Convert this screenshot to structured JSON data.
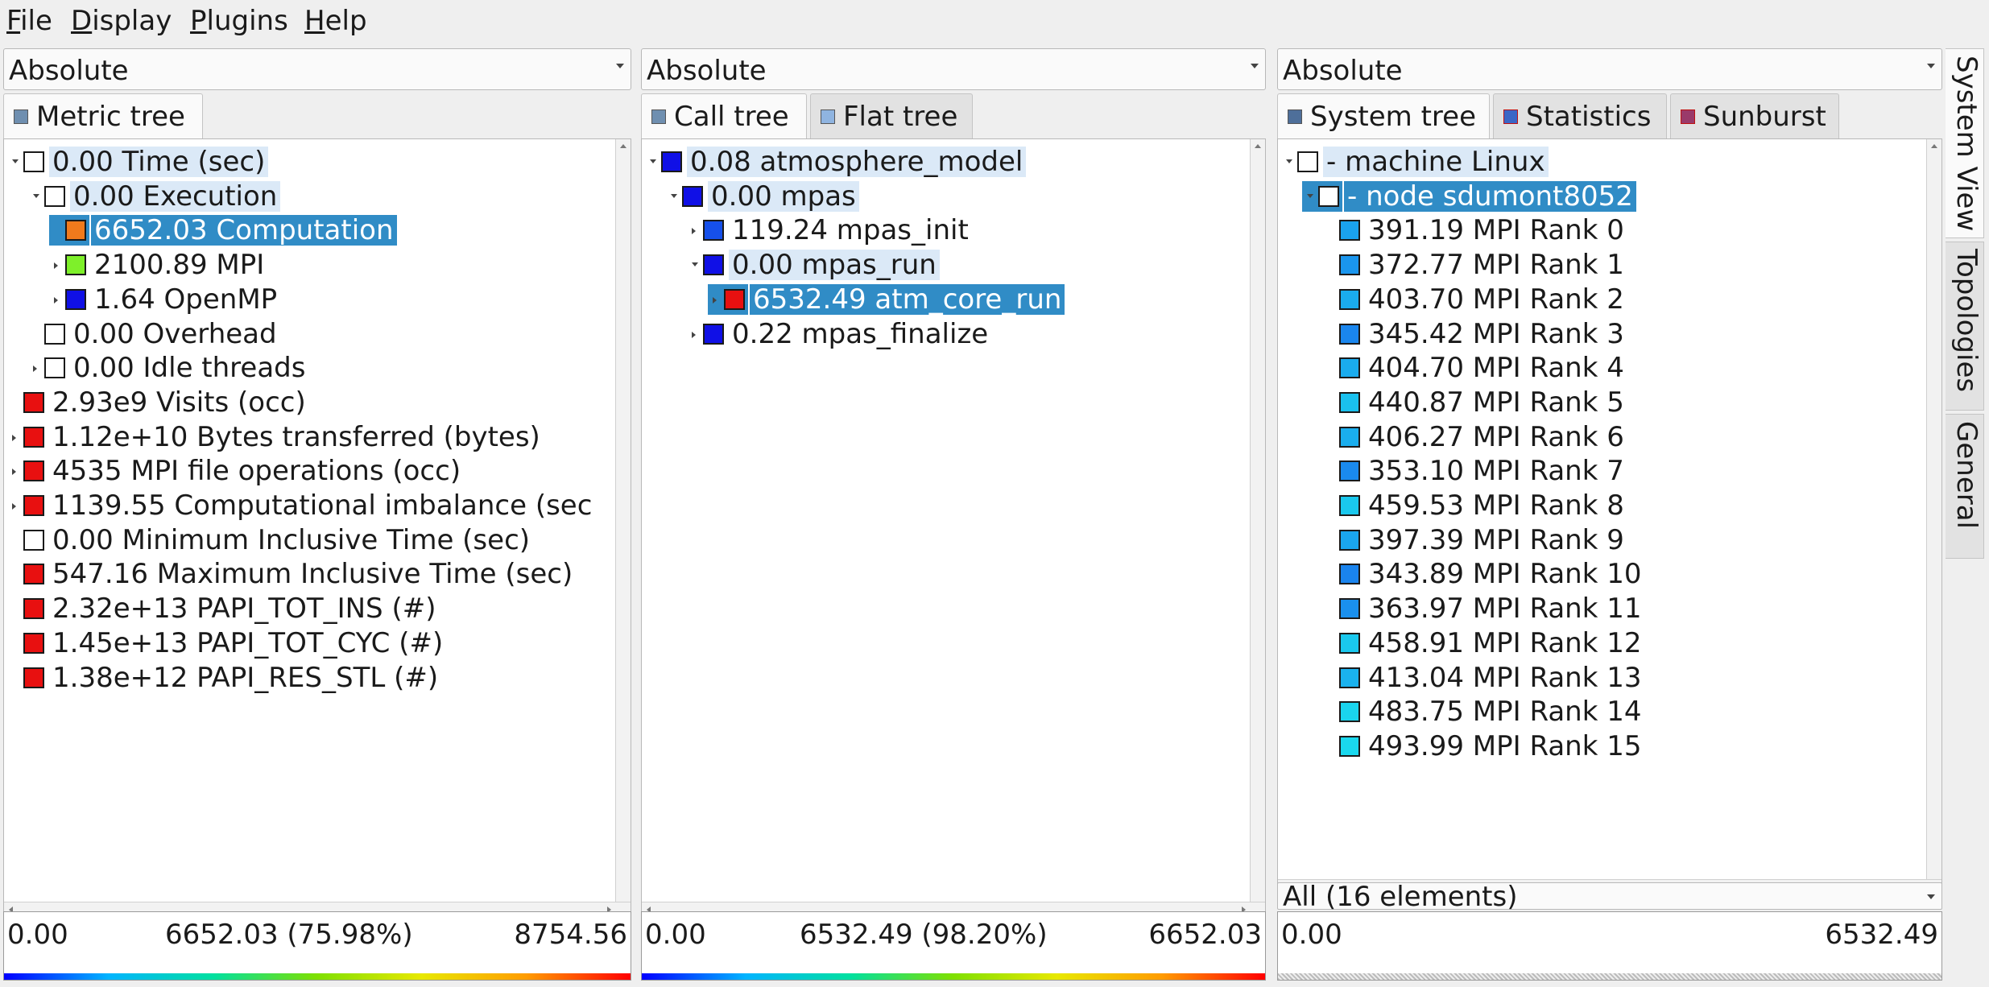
{
  "menubar": {
    "items": [
      {
        "first": "F",
        "rest": "ile"
      },
      {
        "first": "D",
        "rest": "isplay"
      },
      {
        "first": "P",
        "rest": "lugins"
      },
      {
        "first": "H",
        "rest": "elp"
      }
    ]
  },
  "metric_panel": {
    "mode": "Absolute",
    "tabs": [
      {
        "label": "Metric tree"
      }
    ],
    "rows": [
      {
        "text": "0.00 Time (sec)",
        "color": "#ffffff",
        "expander": "open"
      },
      {
        "text": "0.00 Execution",
        "color": "#ffffff",
        "expander": "open"
      },
      {
        "text": "6652.03 Computation",
        "color": "#f07a1c",
        "expander": "none",
        "selected": true
      },
      {
        "text": "2100.89 MPI",
        "color": "#7ef02a",
        "expander": "closed"
      },
      {
        "text": "1.64 OpenMP",
        "color": "#1010e6",
        "expander": "closed"
      },
      {
        "text": "0.00 Overhead",
        "color": "#ffffff",
        "expander": "none"
      },
      {
        "text": "0.00 Idle threads",
        "color": "#ffffff",
        "expander": "closed"
      },
      {
        "text": "2.93e9 Visits (occ)",
        "color": "#e81010",
        "expander": "none"
      },
      {
        "text": "1.12e+10 Bytes transferred (bytes)",
        "color": "#e81010",
        "expander": "closed"
      },
      {
        "text": "4535 MPI file operations (occ)",
        "color": "#e81010",
        "expander": "closed"
      },
      {
        "text": "1139.55 Computational imbalance (sec",
        "color": "#e81010",
        "expander": "closed"
      },
      {
        "text": "0.00 Minimum Inclusive Time (sec)",
        "color": "#ffffff",
        "expander": "none"
      },
      {
        "text": "547.16 Maximum Inclusive Time (sec)",
        "color": "#e81010",
        "expander": "none"
      },
      {
        "text": "2.32e+13 PAPI_TOT_INS (#)",
        "color": "#e81010",
        "expander": "none"
      },
      {
        "text": "1.45e+13 PAPI_TOT_CYC (#)",
        "color": "#e81010",
        "expander": "none"
      },
      {
        "text": "1.38e+12 PAPI_RES_STL (#)",
        "color": "#e81010",
        "expander": "none"
      }
    ],
    "scale": {
      "min": "0.00",
      "mid": "6652.03 (75.98%)",
      "max": "8754.56"
    }
  },
  "call_panel": {
    "mode": "Absolute",
    "tabs": [
      {
        "label": "Call tree"
      },
      {
        "label": "Flat tree"
      }
    ],
    "rows": [
      {
        "text": "0.08 atmosphere_model",
        "color": "#1010e6",
        "expander": "open"
      },
      {
        "text": "0.00 mpas",
        "color": "#1010e6",
        "expander": "open"
      },
      {
        "text": "119.24 mpas_init",
        "color": "#1650ea",
        "expander": "closed"
      },
      {
        "text": "0.00 mpas_run",
        "color": "#1010e6",
        "expander": "open"
      },
      {
        "text": "6532.49 atm_core_run",
        "color": "#e81010",
        "expander": "closed",
        "selected": true
      },
      {
        "text": "0.22 mpas_finalize",
        "color": "#1010e6",
        "expander": "closed"
      }
    ],
    "scale": {
      "min": "0.00",
      "mid": "6532.49 (98.20%)",
      "max": "6652.03"
    }
  },
  "system_panel": {
    "mode": "Absolute",
    "tabs": [
      {
        "label": "System tree"
      },
      {
        "label": "Statistics"
      },
      {
        "label": "Sunburst"
      }
    ],
    "rows": [
      {
        "text": "- machine Linux",
        "color": "#ffffff",
        "expander": "open"
      },
      {
        "text": "- node sdumont8052",
        "color": "#ffffff",
        "expander": "open",
        "selected": true
      },
      {
        "text": "391.19 MPI Rank 0",
        "color": "#1aa2ee",
        "expander": "none"
      },
      {
        "text": "372.77 MPI Rank 1",
        "color": "#1a96ee",
        "expander": "none"
      },
      {
        "text": "403.70 MPI Rank 2",
        "color": "#1aacee",
        "expander": "none"
      },
      {
        "text": "345.42 MPI Rank 3",
        "color": "#1a86ee",
        "expander": "none"
      },
      {
        "text": "404.70 MPI Rank 4",
        "color": "#1aacee",
        "expander": "none"
      },
      {
        "text": "440.87 MPI Rank 5",
        "color": "#1ac0ee",
        "expander": "none"
      },
      {
        "text": "406.27 MPI Rank 6",
        "color": "#1aaeee",
        "expander": "none"
      },
      {
        "text": "353.10 MPI Rank 7",
        "color": "#1a8aee",
        "expander": "none"
      },
      {
        "text": "459.53 MPI Rank 8",
        "color": "#1ac8ee",
        "expander": "none"
      },
      {
        "text": "397.39 MPI Rank 9",
        "color": "#1aa6ee",
        "expander": "none"
      },
      {
        "text": "343.89 MPI Rank 10",
        "color": "#1a84ee",
        "expander": "none"
      },
      {
        "text": "363.97 MPI Rank 11",
        "color": "#1a90ee",
        "expander": "none"
      },
      {
        "text": "458.91 MPI Rank 12",
        "color": "#1ac8ee",
        "expander": "none"
      },
      {
        "text": "413.04 MPI Rank 13",
        "color": "#1ab2ee",
        "expander": "none"
      },
      {
        "text": "483.75 MPI Rank 14",
        "color": "#1ad4ee",
        "expander": "none"
      },
      {
        "text": "493.99 MPI Rank 15",
        "color": "#1ad8ee",
        "expander": "none"
      }
    ],
    "filter": "All (16 elements)",
    "scale": {
      "min": "0.00",
      "max": "6532.49"
    }
  },
  "side_tabs": [
    {
      "label": "System View"
    },
    {
      "label": "Topologies"
    },
    {
      "label": "General"
    }
  ]
}
